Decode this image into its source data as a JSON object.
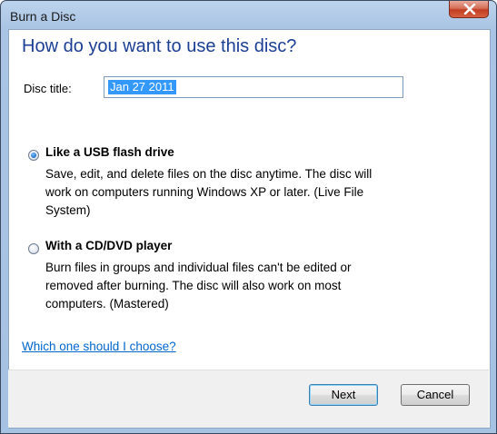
{
  "window": {
    "title": "Burn a Disc"
  },
  "dialog": {
    "heading": "How do you want to use this disc?",
    "disc_title_label": "Disc title:",
    "disc_title_value": "Jan 27 2011",
    "options": [
      {
        "label": "Like a USB flash drive",
        "description_lines": [
          "Save, edit, and delete files on the disc anytime. The disc will",
          "work on computers running Windows XP or later. (Live File",
          "System)"
        ],
        "selected": true
      },
      {
        "label": "With a CD/DVD player",
        "description_lines": [
          "Burn files in groups and individual files can't be edited or",
          "removed after burning. The disc will also work on most",
          "computers. (Mastered)"
        ],
        "selected": false
      }
    ],
    "help_link": "Which one should I choose?"
  },
  "buttons": {
    "next": "Next",
    "cancel": "Cancel"
  },
  "colors": {
    "heading": "#1c3f94",
    "link": "#0066cc",
    "selection": "#3399ff"
  }
}
